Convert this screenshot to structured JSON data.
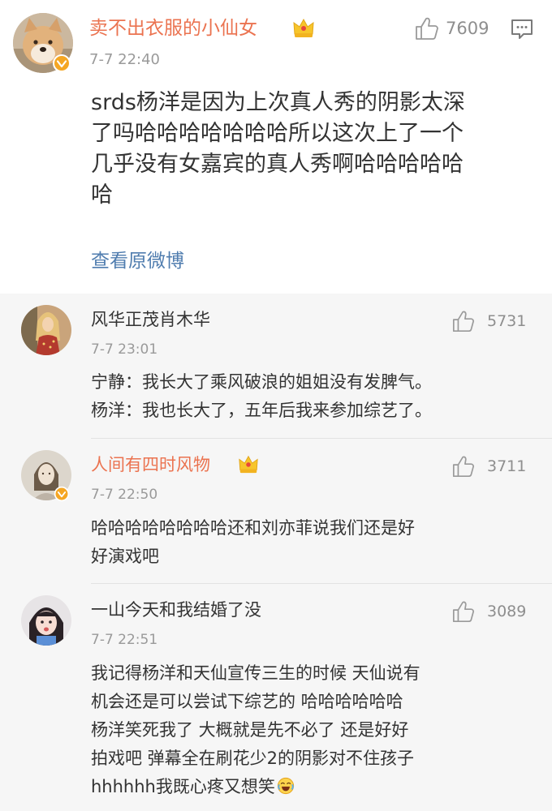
{
  "main_comment": {
    "user_name": "卖不出衣服的小仙女",
    "time": "7-7 22:40",
    "like_count": "7609",
    "text_lines": [
      "srds杨洋是因为上次真人秀的阴影太深",
      "了吗哈哈哈哈哈哈哈所以这次上了一个",
      "几乎没有女嘉宾的真人秀啊哈哈哈哈哈",
      "哈"
    ],
    "view_original": "查看原微博",
    "icons": {
      "verified": "verified-badge-icon",
      "vip": "crown-icon",
      "like": "thumbs-up-icon",
      "reply": "comment-icon"
    }
  },
  "replies": [
    {
      "user_name": "风华正茂肖木华",
      "time": "7-7 23:01",
      "like_count": "5731",
      "text_lines": [
        "宁静：我长大了乘风破浪的姐姐没有发脾气。",
        "杨洋：我也长大了，五年后我来参加综艺了。"
      ]
    },
    {
      "user_name": "人间有四时风物",
      "time": "7-7 22:50",
      "like_count": "3711",
      "text_lines": [
        "哈哈哈哈哈哈哈哈还和刘亦菲说我们还是好",
        "好演戏吧"
      ]
    },
    {
      "user_name": "一山今天和我结婚了没",
      "time": "7-7 22:51",
      "like_count": "3089",
      "text_lines": [
        "我记得杨洋和天仙宣传三生的时候 天仙说有",
        "机会还是可以尝试下综艺的 哈哈哈哈哈哈",
        "杨洋笑死我了 大概就是先不必了 还是好好",
        "拍戏吧 弹幕全在刷花少2的阴影对不住孩子",
        "hhhhhh我既心疼又想笑"
      ]
    }
  ],
  "colors": {
    "vip_name": "#eb7350",
    "link": "#507daf",
    "meta": "#9a9a9a",
    "replies_bg": "#f6f6f6",
    "verified": "#f5a623"
  }
}
